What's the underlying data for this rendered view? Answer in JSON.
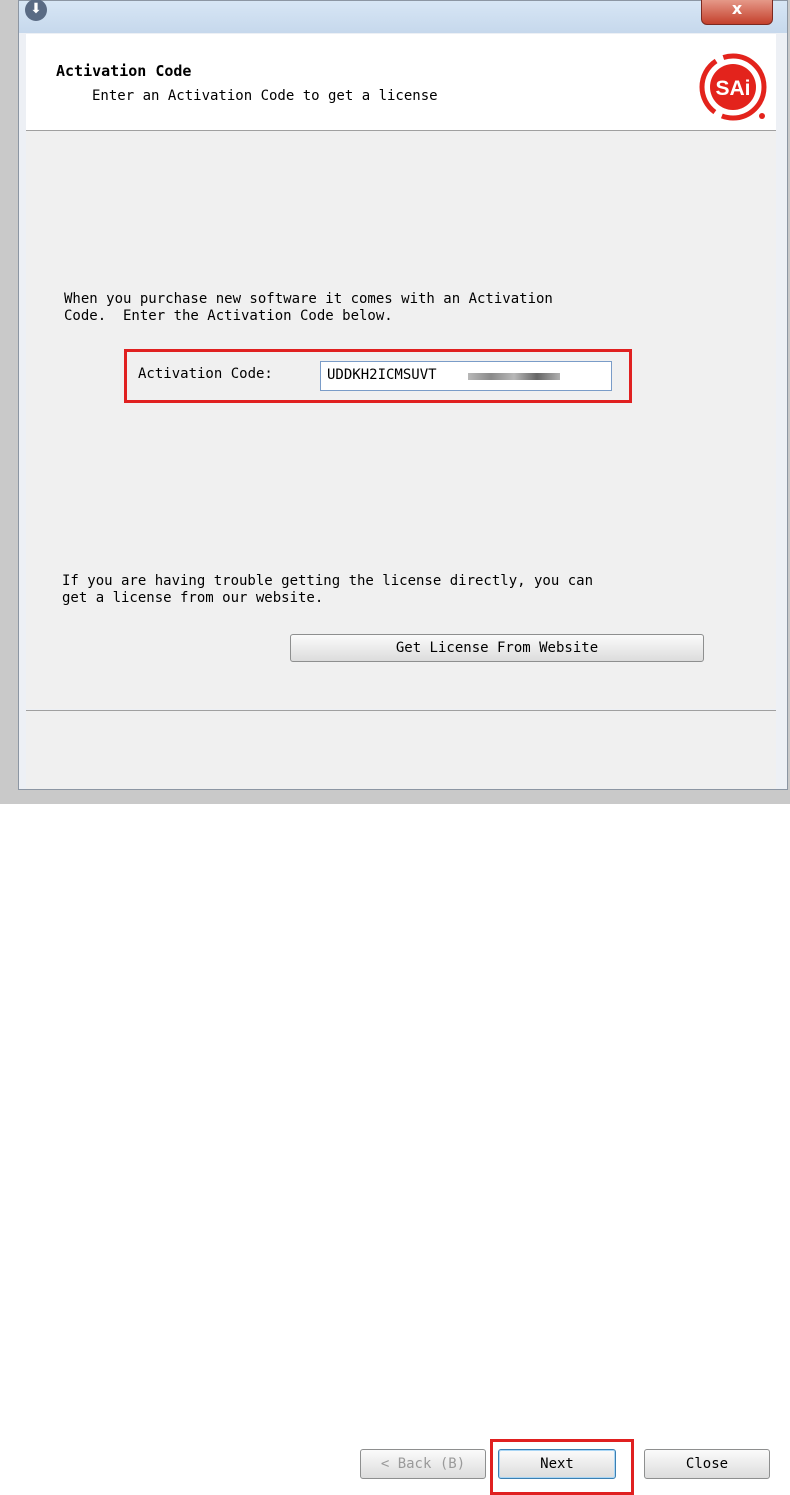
{
  "window": {
    "title_icon": "download-arrow-icon",
    "close_glyph": "x"
  },
  "header": {
    "title": "Activation Code",
    "subtitle": "Enter an Activation Code to get a license",
    "logo_text": "SAi",
    "logo_color": "#e3231c"
  },
  "body": {
    "intro": "When you purchase new software it comes with an Activation\nCode.  Enter the Activation Code below.",
    "activation_label": "Activation Code:",
    "activation_value": "UDDKH2ICMSUVT",
    "trouble": "If you are having trouble getting the license directly, you can\nget a license from our website.",
    "website_button": "Get License From Website"
  },
  "footer": {
    "back_button": "< Back (B)",
    "next_button": "Next",
    "close_button": "Close"
  },
  "colors": {
    "highlight": "#e02020",
    "accent_blue": "#3c7fb1"
  }
}
